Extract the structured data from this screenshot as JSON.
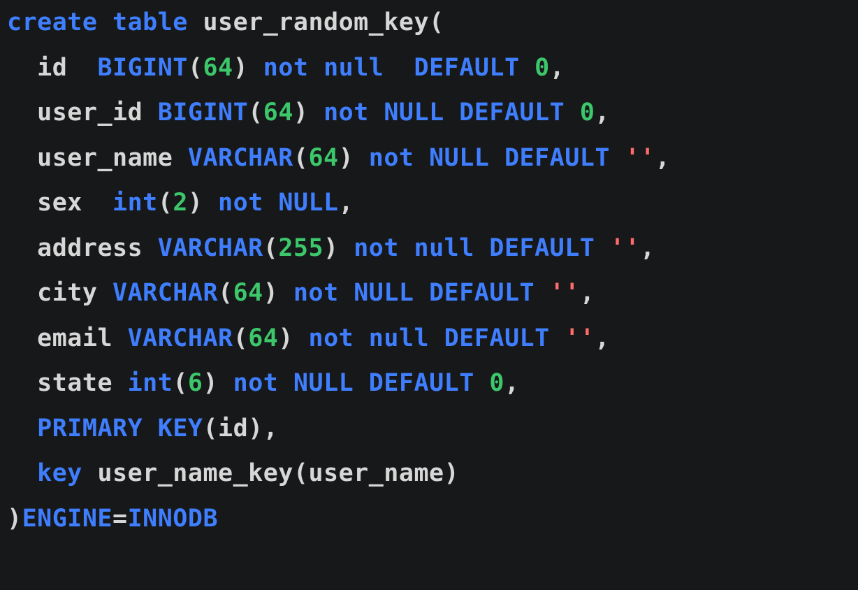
{
  "code": {
    "lines": [
      {
        "indent": 0,
        "parts": [
          {
            "cls": "kw",
            "t": "create"
          },
          {
            "cls": "pl",
            "t": " "
          },
          {
            "cls": "kw",
            "t": "table"
          },
          {
            "cls": "pl",
            "t": " user_random_key("
          }
        ]
      },
      {
        "indent": 1,
        "parts": [
          {
            "cls": "pl",
            "t": "id  "
          },
          {
            "cls": "kw",
            "t": "BIGINT"
          },
          {
            "cls": "pl",
            "t": "("
          },
          {
            "cls": "num",
            "t": "64"
          },
          {
            "cls": "pl",
            "t": ") "
          },
          {
            "cls": "kw",
            "t": "not"
          },
          {
            "cls": "pl",
            "t": " "
          },
          {
            "cls": "kw",
            "t": "null"
          },
          {
            "cls": "pl",
            "t": "  "
          },
          {
            "cls": "kw",
            "t": "DEFAULT"
          },
          {
            "cls": "pl",
            "t": " "
          },
          {
            "cls": "num",
            "t": "0"
          },
          {
            "cls": "pl",
            "t": ","
          }
        ]
      },
      {
        "indent": 1,
        "parts": [
          {
            "cls": "pl",
            "t": "user_id "
          },
          {
            "cls": "kw",
            "t": "BIGINT"
          },
          {
            "cls": "pl",
            "t": "("
          },
          {
            "cls": "num",
            "t": "64"
          },
          {
            "cls": "pl",
            "t": ") "
          },
          {
            "cls": "kw",
            "t": "not"
          },
          {
            "cls": "pl",
            "t": " "
          },
          {
            "cls": "kw",
            "t": "NULL"
          },
          {
            "cls": "pl",
            "t": " "
          },
          {
            "cls": "kw",
            "t": "DEFAULT"
          },
          {
            "cls": "pl",
            "t": " "
          },
          {
            "cls": "num",
            "t": "0"
          },
          {
            "cls": "pl",
            "t": ","
          }
        ]
      },
      {
        "indent": 1,
        "parts": [
          {
            "cls": "pl",
            "t": "user_name "
          },
          {
            "cls": "kw",
            "t": "VARCHAR"
          },
          {
            "cls": "pl",
            "t": "("
          },
          {
            "cls": "num",
            "t": "64"
          },
          {
            "cls": "pl",
            "t": ") "
          },
          {
            "cls": "kw",
            "t": "not"
          },
          {
            "cls": "pl",
            "t": " "
          },
          {
            "cls": "kw",
            "t": "NULL"
          },
          {
            "cls": "pl",
            "t": " "
          },
          {
            "cls": "kw",
            "t": "DEFAULT"
          },
          {
            "cls": "pl",
            "t": " "
          },
          {
            "cls": "str",
            "t": "''"
          },
          {
            "cls": "pl",
            "t": ","
          }
        ]
      },
      {
        "indent": 1,
        "parts": [
          {
            "cls": "pl",
            "t": "sex  "
          },
          {
            "cls": "kw",
            "t": "int"
          },
          {
            "cls": "pl",
            "t": "("
          },
          {
            "cls": "num",
            "t": "2"
          },
          {
            "cls": "pl",
            "t": ") "
          },
          {
            "cls": "kw",
            "t": "not"
          },
          {
            "cls": "pl",
            "t": " "
          },
          {
            "cls": "kw",
            "t": "NULL"
          },
          {
            "cls": "pl",
            "t": ","
          }
        ]
      },
      {
        "indent": 1,
        "parts": [
          {
            "cls": "pl",
            "t": "address "
          },
          {
            "cls": "kw",
            "t": "VARCHAR"
          },
          {
            "cls": "pl",
            "t": "("
          },
          {
            "cls": "num",
            "t": "255"
          },
          {
            "cls": "pl",
            "t": ") "
          },
          {
            "cls": "kw",
            "t": "not"
          },
          {
            "cls": "pl",
            "t": " "
          },
          {
            "cls": "kw",
            "t": "null"
          },
          {
            "cls": "pl",
            "t": " "
          },
          {
            "cls": "kw",
            "t": "DEFAULT"
          },
          {
            "cls": "pl",
            "t": " "
          },
          {
            "cls": "str",
            "t": "''"
          },
          {
            "cls": "pl",
            "t": ","
          }
        ]
      },
      {
        "indent": 1,
        "parts": [
          {
            "cls": "pl",
            "t": "city "
          },
          {
            "cls": "kw",
            "t": "VARCHAR"
          },
          {
            "cls": "pl",
            "t": "("
          },
          {
            "cls": "num",
            "t": "64"
          },
          {
            "cls": "pl",
            "t": ") "
          },
          {
            "cls": "kw",
            "t": "not"
          },
          {
            "cls": "pl",
            "t": " "
          },
          {
            "cls": "kw",
            "t": "NULL"
          },
          {
            "cls": "pl",
            "t": " "
          },
          {
            "cls": "kw",
            "t": "DEFAULT"
          },
          {
            "cls": "pl",
            "t": " "
          },
          {
            "cls": "str",
            "t": "''"
          },
          {
            "cls": "pl",
            "t": ","
          }
        ]
      },
      {
        "indent": 1,
        "parts": [
          {
            "cls": "pl",
            "t": "email "
          },
          {
            "cls": "kw",
            "t": "VARCHAR"
          },
          {
            "cls": "pl",
            "t": "("
          },
          {
            "cls": "num",
            "t": "64"
          },
          {
            "cls": "pl",
            "t": ") "
          },
          {
            "cls": "kw",
            "t": "not"
          },
          {
            "cls": "pl",
            "t": " "
          },
          {
            "cls": "kw",
            "t": "null"
          },
          {
            "cls": "pl",
            "t": " "
          },
          {
            "cls": "kw",
            "t": "DEFAULT"
          },
          {
            "cls": "pl",
            "t": " "
          },
          {
            "cls": "str",
            "t": "''"
          },
          {
            "cls": "pl",
            "t": ","
          }
        ]
      },
      {
        "indent": 1,
        "parts": [
          {
            "cls": "pl",
            "t": "state "
          },
          {
            "cls": "kw",
            "t": "int"
          },
          {
            "cls": "pl",
            "t": "("
          },
          {
            "cls": "num",
            "t": "6"
          },
          {
            "cls": "pl",
            "t": ") "
          },
          {
            "cls": "kw",
            "t": "not"
          },
          {
            "cls": "pl",
            "t": " "
          },
          {
            "cls": "kw",
            "t": "NULL"
          },
          {
            "cls": "pl",
            "t": " "
          },
          {
            "cls": "kw",
            "t": "DEFAULT"
          },
          {
            "cls": "pl",
            "t": " "
          },
          {
            "cls": "num",
            "t": "0"
          },
          {
            "cls": "pl",
            "t": ","
          }
        ]
      },
      {
        "indent": 1,
        "parts": [
          {
            "cls": "kw",
            "t": "PRIMARY"
          },
          {
            "cls": "pl",
            "t": " "
          },
          {
            "cls": "kw",
            "t": "KEY"
          },
          {
            "cls": "pl",
            "t": "(id),"
          }
        ]
      },
      {
        "indent": 1,
        "parts": [
          {
            "cls": "kw",
            "t": "key"
          },
          {
            "cls": "pl",
            "t": " user_name_key(user_name)"
          }
        ]
      },
      {
        "indent": 0,
        "parts": [
          {
            "cls": "pl",
            "t": ")"
          },
          {
            "cls": "kw",
            "t": "ENGINE"
          },
          {
            "cls": "pl",
            "t": "="
          },
          {
            "cls": "kw",
            "t": "INNODB"
          }
        ]
      }
    ],
    "indent_unit": "  "
  }
}
